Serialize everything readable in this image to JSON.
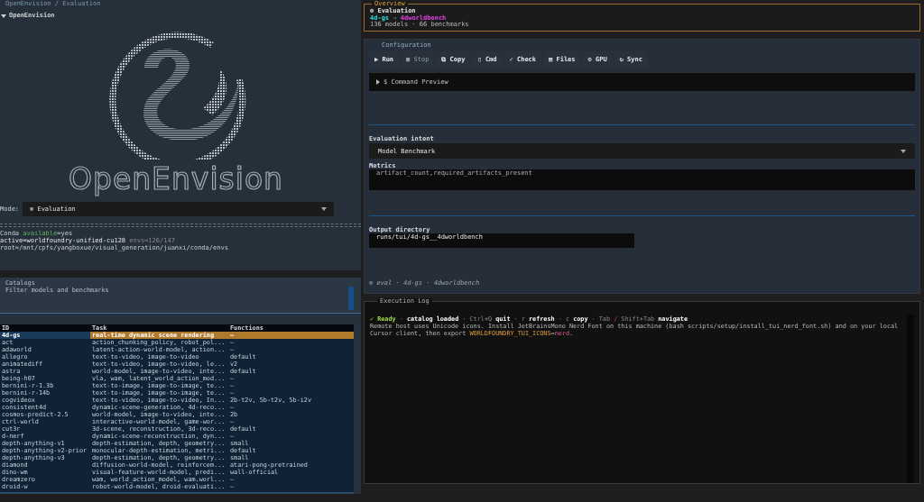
{
  "breadcrumb": "OpenEnvision / Evaluation",
  "tree_header": {
    "label": "OpenEnvision",
    "expanded": true
  },
  "logo": {
    "wordmark": "OpenEnvision"
  },
  "mode": {
    "label": "Mode:",
    "icon": "⊚",
    "value": "Evaluation"
  },
  "conda": [
    {
      "segments": [
        {
          "text": "Conda ",
          "kind": "plain"
        },
        {
          "text": "available",
          "kind": "positive"
        },
        {
          "text": "=yes",
          "kind": "plain"
        }
      ]
    },
    {
      "segments": [
        {
          "text": "active=worldfoundry-unified-cu128",
          "kind": "bright"
        },
        {
          "text": " envs=126/147",
          "kind": "muted"
        }
      ]
    },
    {
      "segments": [
        {
          "text": "root=/mnt/cpfs/yangboxue/visual_generation/juanxi/conda/envs",
          "kind": "plain"
        }
      ]
    }
  ],
  "catalogs": {
    "title": "Catalogs",
    "subtitle": "Filter models and benchmarks",
    "table": {
      "columns": [
        "ID",
        "Task",
        "Functions"
      ],
      "rows": [
        {
          "cells": [
            "4d-gs",
            "real-time dynamic scene rendering",
            "–"
          ],
          "selected": true
        },
        {
          "cells": [
            "act",
            "action_chunking_policy, robot_pol...",
            "–"
          ],
          "selected": false
        },
        {
          "cells": [
            "adaworld",
            "latent-action-world-model, action...",
            "–"
          ],
          "selected": false
        },
        {
          "cells": [
            "allegro",
            "text-to-video, image-to-video",
            "default"
          ],
          "selected": false
        },
        {
          "cells": [
            "animatediff",
            "text-to-video, image-to-video, le...",
            "v2"
          ],
          "selected": false
        },
        {
          "cells": [
            "astra",
            "world-model, image-to-video, inte...",
            "default"
          ],
          "selected": false
        },
        {
          "cells": [
            "being-h07",
            "vla, wam, latent_world_action_mod...",
            "–"
          ],
          "selected": false
        },
        {
          "cells": [
            "bernini-r-1.3b",
            "text-to-image, image-to-image, te...",
            "–"
          ],
          "selected": false
        },
        {
          "cells": [
            "bernini-r-14b",
            "text-to-image, image-to-image, te...",
            "–"
          ],
          "selected": false
        },
        {
          "cells": [
            "cogvideox",
            "text-to-video, image-to-video, In...",
            "2b-t2v, 5b-t2v, 5b-i2v"
          ],
          "selected": false
        },
        {
          "cells": [
            "consistent4d",
            "dynamic-scene-generation, 4d-reco...",
            "–"
          ],
          "selected": false
        },
        {
          "cells": [
            "cosmos-predict-2.5",
            "world-model, image-to-video, inte...",
            "2b"
          ],
          "selected": false
        },
        {
          "cells": [
            "ctrl-world",
            "interactive-world-model, game-wor...",
            "–"
          ],
          "selected": false
        },
        {
          "cells": [
            "cut3r",
            "3d-scene, reconstruction, 3d-reco...",
            "default"
          ],
          "selected": false
        },
        {
          "cells": [
            "d-nerf",
            "dynamic-scene-reconstruction, dyn...",
            "–"
          ],
          "selected": false
        },
        {
          "cells": [
            "depth-anything-v1",
            "depth-estimation, depth, geometry...",
            "small"
          ],
          "selected": false
        },
        {
          "cells": [
            "depth-anything-v2-prior",
            "monocular-depth-estimation, metri...",
            "default"
          ],
          "selected": false
        },
        {
          "cells": [
            "depth-anything-v3",
            "depth-estimation, depth, geometry...",
            "small"
          ],
          "selected": false
        },
        {
          "cells": [
            "diamond",
            "diffusion-world-model, reinforcem...",
            "atari-pong-pretrained"
          ],
          "selected": false
        },
        {
          "cells": [
            "dino-wm",
            "visual-feature-world-model, predi...",
            "wall-official"
          ],
          "selected": false
        },
        {
          "cells": [
            "dreamzero",
            "wam, world_action_model, wam.worl...",
            "–"
          ],
          "selected": false
        },
        {
          "cells": [
            "droid-w",
            "robot-world-model, droid-evaluati...",
            "–"
          ],
          "selected": false
        }
      ]
    }
  },
  "overview": {
    "legend": "Overview",
    "icon": "⊚",
    "title": "Evaluation",
    "model": "4d-gs",
    "arrow": "→",
    "benchmark": "4dworldbench",
    "summary": "136 models · 66 benchmarks"
  },
  "configuration": {
    "legend": "Configuration",
    "buttons": [
      {
        "icon": "▶",
        "label": "Run",
        "disabled": false
      },
      {
        "icon": "■",
        "label": "Stop",
        "disabled": true
      },
      {
        "icon": "⧉",
        "label": "Copy",
        "disabled": false
      },
      {
        "icon": "▯",
        "label": "Cmd",
        "disabled": false
      },
      {
        "icon": "✓",
        "label": "Check",
        "disabled": false
      },
      {
        "icon": "▤",
        "label": "Files",
        "disabled": false
      },
      {
        "icon": "⚙",
        "label": "GPU",
        "disabled": false
      },
      {
        "icon": "↻",
        "label": "Sync",
        "disabled": false
      }
    ],
    "command_preview": {
      "label": "$ Command Preview",
      "expanded": false
    },
    "intent": {
      "label": "Evaluation intent",
      "value": "Model Benchmark"
    },
    "metrics": {
      "label": "Metrics",
      "value": "artifact_count,required_artifacts_present"
    },
    "output": {
      "label": "Output directory",
      "value": "runs/tui/4d-gs__4dworldbench"
    },
    "footer": "⊚ eval · 4d-gs · 4dworldbench"
  },
  "log": {
    "legend": "Execution Log",
    "lines": [
      {
        "segments": [
          {
            "text": "✓ Ready",
            "kind": "success"
          },
          {
            "text": " · ",
            "kind": "muted"
          },
          {
            "text": "catalog loaded",
            "kind": "strong"
          },
          {
            "text": " · Ctrl+Q ",
            "kind": "muted"
          },
          {
            "text": "quit",
            "kind": "strong"
          },
          {
            "text": " · r ",
            "kind": "muted"
          },
          {
            "text": "refresh",
            "kind": "strong"
          },
          {
            "text": " · c ",
            "kind": "muted"
          },
          {
            "text": "copy",
            "kind": "strong"
          },
          {
            "text": " · Tab ",
            "kind": "muted"
          },
          {
            "text": "/",
            "kind": "separator"
          },
          {
            "text": " Shift+Tab ",
            "kind": "muted"
          },
          {
            "text": "navigate",
            "kind": "strong"
          }
        ]
      },
      {
        "segments": [
          {
            "text": "Remote host uses Unicode icons. Install JetBrainsMono Nerd Font on this machine (bash scripts/setup/install_tui_nerd_font.sh) and on your local Cursor client, then export ",
            "kind": "plain"
          },
          {
            "text": "WORLDFOUNDRY_TUI_ICONS",
            "kind": "key"
          },
          {
            "text": "=",
            "kind": "plain"
          },
          {
            "text": "nerd",
            "kind": "value"
          },
          {
            "text": ".",
            "kind": "plain"
          }
        ]
      }
    ]
  }
}
